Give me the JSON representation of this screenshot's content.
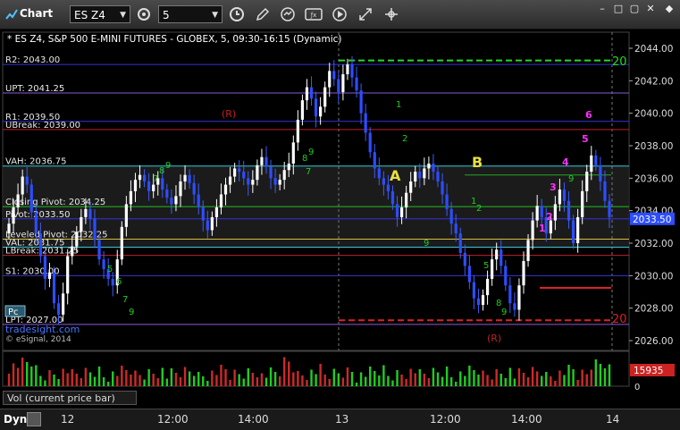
{
  "toolbar": {
    "app_title": "Chart",
    "symbol": "ES Z4",
    "interval": "5"
  },
  "chart": {
    "title": "* ES Z4, S&P 500 E-MINI FUTURES - GLOBEX, 5, 09:30-16:15 (Dynamic)",
    "copyright": "© eSignal, 2014",
    "watermark": "tradesight.com",
    "current_price_label": "2033.50",
    "volume_value_label": "15935",
    "volume_axis_zero": "0",
    "pivot_button": "Pc",
    "y_ticks": [
      "2044.00",
      "2042.00",
      "2040.00",
      "2038.00",
      "2036.00",
      "2034.00",
      "2032.00",
      "2030.00",
      "2028.00",
      "2026.00"
    ],
    "x_ticks": [
      "12",
      "12:00",
      "14:00",
      "13",
      "12:00",
      "14:00",
      "14"
    ],
    "levels": [
      {
        "label": "R2: 2043.00",
        "price": 2043.0,
        "color": "#3434d8"
      },
      {
        "label": "UPT: 2041.25",
        "price": 2041.25,
        "color": "#8a5ad8"
      },
      {
        "label": "R1: 2039.50",
        "price": 2039.5,
        "color": "#3434d8"
      },
      {
        "label": "UBreak: 2039.00",
        "price": 2039.0,
        "color": "#c0202a"
      },
      {
        "label": "VAH: 2036.75",
        "price": 2036.75,
        "color": "#38c8d8"
      },
      {
        "label": "Closing Pivot: 2034.25",
        "price": 2034.25,
        "color": "#20c020"
      },
      {
        "label": "Pivot: 2033.50",
        "price": 2033.5,
        "color": "#3434d8"
      },
      {
        "label": "Leveled Pivot: 2032.25",
        "price": 2032.25,
        "color": "#d8c040"
      },
      {
        "label": "VAL: 2031.75",
        "price": 2031.75,
        "color": "#38c8d8"
      },
      {
        "label": "LBreak: 2031.25",
        "price": 2031.25,
        "color": "#c0202a"
      },
      {
        "label": "S1: 2030.00",
        "price": 2030.0,
        "color": "#3434d8"
      },
      {
        "label": "LPT: 2027.00",
        "price": 2027.0,
        "color": "#8a5ad8"
      }
    ],
    "annotations": {
      "letter_a": "A",
      "letter_b": "B",
      "upper_r": "(R)",
      "lower_r": "(R)",
      "target_top": "20",
      "target_bottom": "20"
    },
    "magenta_counts": [
      "1",
      "2",
      "3",
      "4",
      "5",
      "6"
    ]
  },
  "volume_panel": {
    "label": "Vol (current price bar)"
  },
  "footer": {
    "dyn": "Dyn"
  }
}
